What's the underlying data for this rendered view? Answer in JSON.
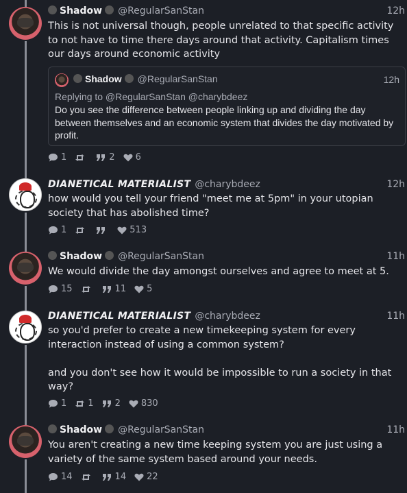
{
  "posts": [
    {
      "name": "Shadow",
      "handle": "@RegularSanStan",
      "time": "12h",
      "text": "This is not universal though, people unrelated to that specific activity to not have to time there days around that activity. Capitalism times our days around economic activity",
      "quote": {
        "name": "Shadow",
        "handle": "@RegularSanStan",
        "time": "12h",
        "replying": "Replying to @RegularSanStan @charybdeez",
        "text": "Do you see the difference between  people linking up and dividing the day between themselves and an economic system that divides the day motivated by profit."
      },
      "replies": "1",
      "reposts": "",
      "quotes": "2",
      "likes": "6"
    },
    {
      "name": "DIANETICAL MATERIALIST",
      "handle": "@charybdeez",
      "time": "12h",
      "text": "how would you tell your friend \"meet me at 5pm\" in your utopian society that has abolished time?",
      "replies": "1",
      "reposts": "",
      "quotes": "",
      "likes": "513"
    },
    {
      "name": "Shadow",
      "handle": "@RegularSanStan",
      "time": "11h",
      "text": "We would divide the day amongst ourselves and agree to meet at 5.",
      "replies": "15",
      "reposts": "",
      "quotes": "11",
      "likes": "5"
    },
    {
      "name": "DIANETICAL MATERIALIST",
      "handle": "@charybdeez",
      "time": "11h",
      "text": "so you'd prefer to create a new timekeeping system for every interaction instead of using a common system?\n\nand you don't see how it would be impossible to run a society in that way?",
      "replies": "1",
      "reposts": "1",
      "quotes": "2",
      "likes": "830"
    },
    {
      "name": "Shadow",
      "handle": "@RegularSanStan",
      "time": "11h",
      "text": "You aren't creating a new time keeping system you are just using a variety of the same system based around your needs.",
      "replies": "14",
      "reposts": "",
      "quotes": "14",
      "likes": "22"
    }
  ],
  "colors": {
    "background": "#1c1f26",
    "text": "#e6e6ea",
    "muted": "#a9acb5",
    "thread_line": "#8a8d96"
  }
}
